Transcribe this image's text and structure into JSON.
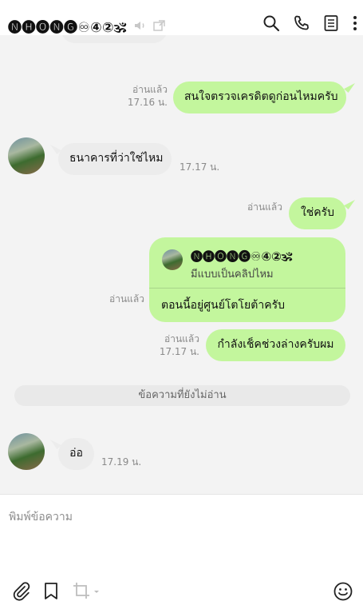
{
  "header": {
    "title": "🅝🅗🅞🅝🅖♾④②🕉",
    "icons": [
      "mute-icon",
      "external-window-icon",
      "search-icon",
      "phone-icon",
      "notes-icon",
      "more-vertical-icon"
    ]
  },
  "messages": [
    {
      "id": "m1",
      "side": "out",
      "text": "สนใจตรวจเครดิตดูก่อนไหมครับ",
      "read": "อ่านแล้ว",
      "time": "17.16 น."
    },
    {
      "id": "m2",
      "side": "in",
      "text": "ธนาคารที่ว่าใช่ไหม",
      "time": "17.17 น."
    },
    {
      "id": "m3",
      "side": "out",
      "text": "ใช่ครับ",
      "read": "อ่านแล้ว"
    },
    {
      "id": "m4",
      "side": "out",
      "reply_to_name": "🅝🅗🅞🅝🅖♾④②🕉",
      "reply_to_text": "มีแบบเป็นคลิปไหม",
      "text": "ตอนนี้อยู่ศูนย์โตโยต้าครับ",
      "read": "อ่านแล้ว"
    },
    {
      "id": "m5",
      "side": "out",
      "text": "กำลังเช็คช่วงล่างครับผม",
      "read": "อ่านแล้ว",
      "time": "17.17 น."
    },
    {
      "id": "m6",
      "side": "in",
      "text": "อ่อ",
      "time": "17.19 น."
    }
  ],
  "unread_divider": "ข้อความที่ยังไม่อ่าน",
  "input": {
    "placeholder": "พิมพ์ข้อความ"
  },
  "toolbar": {
    "icons": [
      "attach-icon",
      "bookmark-icon",
      "crop-icon",
      "emoji-icon"
    ]
  },
  "colors": {
    "outgoing_bubble": "#c3f69d",
    "incoming_bubble": "#ececec",
    "chat_bg": "#f3f3f3"
  }
}
